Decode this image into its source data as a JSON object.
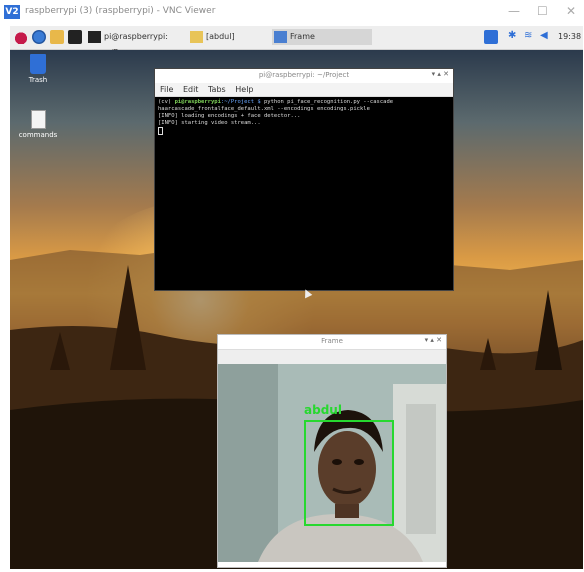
{
  "vnc": {
    "logo": "V2",
    "title": "raspberrypi (3) (raspberrypi) - VNC Viewer",
    "min": "—",
    "max": "☐",
    "close": "✕"
  },
  "taskbar": {
    "tasks": [
      {
        "label": "pi@raspberrypi: ~/Pr..."
      },
      {
        "label": "[abdul]"
      },
      {
        "label": "Frame"
      }
    ],
    "clock": "19:38"
  },
  "desktop": {
    "icons": [
      {
        "label": "Trash"
      },
      {
        "label": "commands"
      }
    ]
  },
  "terminal": {
    "title": "pi@raspberrypi: ~/Project",
    "controls": "▾ ▴ ✕",
    "menu": [
      "File",
      "Edit",
      "Tabs",
      "Help"
    ],
    "lines": {
      "env": "(cv) ",
      "user": "pi@raspberrypi",
      "path": ":~/Project $ ",
      "cmd": "python pi_face_recognition.py --cascade haarcascade_frontalface_default.xml --encodings encodings.pickle",
      "l2": "[INFO] loading encodings + face detector...",
      "l3": "[INFO] starting video stream..."
    }
  },
  "frame": {
    "title": "Frame",
    "controls": "▾ ▴ ✕",
    "detection_label": "abdul"
  },
  "colors": {
    "detect": "#27d82f",
    "prompt": "#7fd35a"
  }
}
